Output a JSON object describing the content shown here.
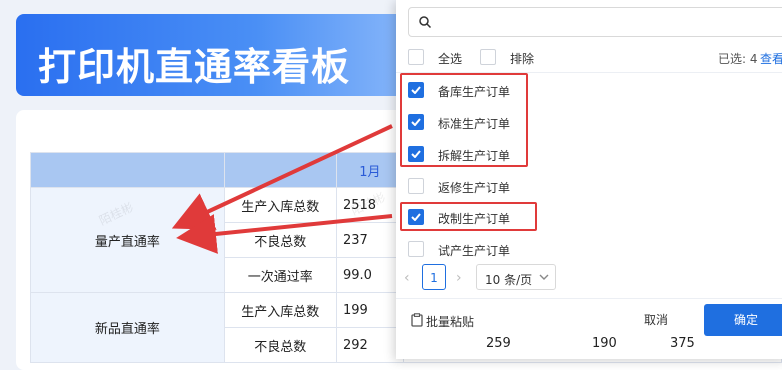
{
  "dashboard": {
    "title": "打印机直通率看板",
    "header_month": "1月",
    "groups": [
      {
        "name": "量产直通率",
        "rows": [
          {
            "metric": "生产入库总数",
            "value": "2518"
          },
          {
            "metric": "不良总数",
            "value": "237"
          },
          {
            "metric": "一次通过率",
            "value": "99.0"
          }
        ]
      },
      {
        "name": "新品直通率",
        "rows": [
          {
            "metric": "生产入库总数",
            "value": "199"
          },
          {
            "metric": "不良总数",
            "value": "292"
          }
        ]
      }
    ],
    "bottom_values": [
      "259",
      "190",
      "375"
    ],
    "watermark": "陌桂彬"
  },
  "popup": {
    "search": {
      "placeholder": "",
      "value": ""
    },
    "select_all_label": "全选",
    "exclude_label": "排除",
    "selected_info": "已选: 4",
    "view_link": "查看",
    "options": [
      {
        "label": "备库生产订单",
        "checked": true
      },
      {
        "label": "标准生产订单",
        "checked": true
      },
      {
        "label": "拆解生产订单",
        "checked": true
      },
      {
        "label": "返修生产订单",
        "checked": false
      },
      {
        "label": "改制生产订单",
        "checked": true
      },
      {
        "label": "试产生产订单",
        "checked": false
      }
    ],
    "pagination": {
      "prev": "‹",
      "page": "1",
      "next": "›",
      "page_size": "10 条/页"
    },
    "batch_paste_label": "批量粘贴",
    "cancel_label": "取消",
    "confirm_label": "确定"
  },
  "colors": {
    "accent": "#1f6fe0",
    "highlight": "#e03a3a",
    "banner": "#2a6ff0"
  },
  "icons": [
    "search-icon",
    "check-icon",
    "chevron-down-icon",
    "paste-icon",
    "arrow-annotation"
  ]
}
